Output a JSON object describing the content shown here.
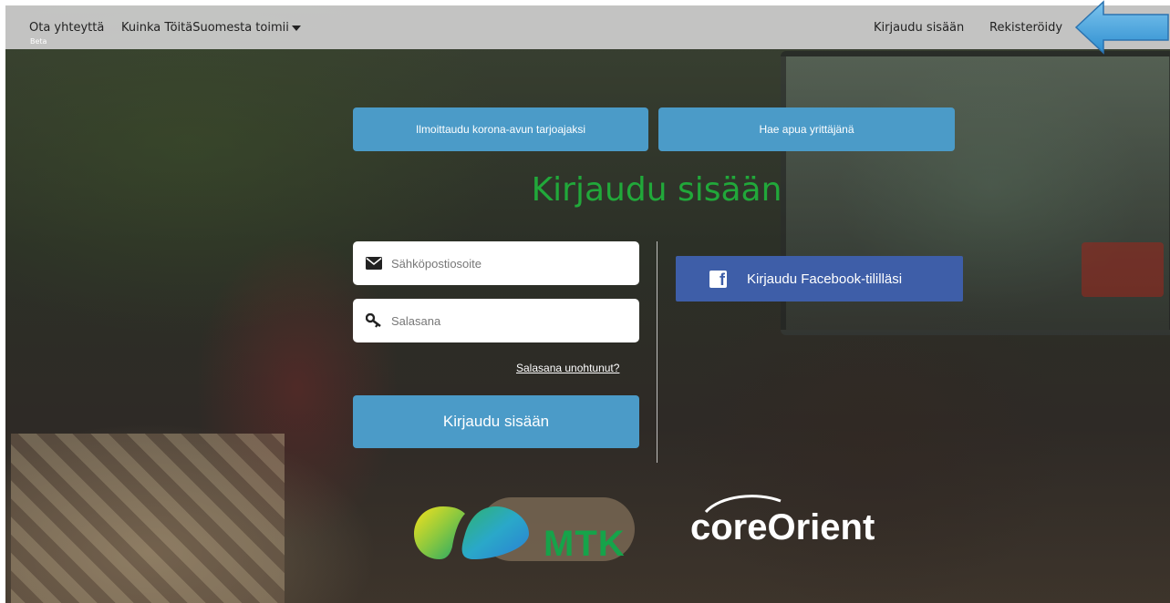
{
  "nav": {
    "contact": "Ota yhteyttä",
    "how_it_works": "Kuinka TöitäSuomesta toimii",
    "beta": "Beta",
    "login": "Kirjaudu sisään",
    "register": "Rekisteröidy"
  },
  "actions": {
    "offer_help": "Ilmoittaudu korona-avun tarjoajaksi",
    "seek_help": "Hae apua yrittäjänä"
  },
  "login": {
    "title": "Kirjaudu sisään",
    "email_placeholder": "Sähköpostiosoite",
    "password_placeholder": "Salasana",
    "forgot": "Salasana unohtunut?",
    "submit": "Kirjaudu sisään",
    "facebook": "Kirjaudu Facebook-tililläsi"
  },
  "logos": {
    "mtk": "MTK",
    "core_orient": "coreOrient"
  },
  "colors": {
    "button_blue": "#4b9bc8",
    "title_green": "#21a83a",
    "facebook_blue": "#3e5ea8"
  }
}
